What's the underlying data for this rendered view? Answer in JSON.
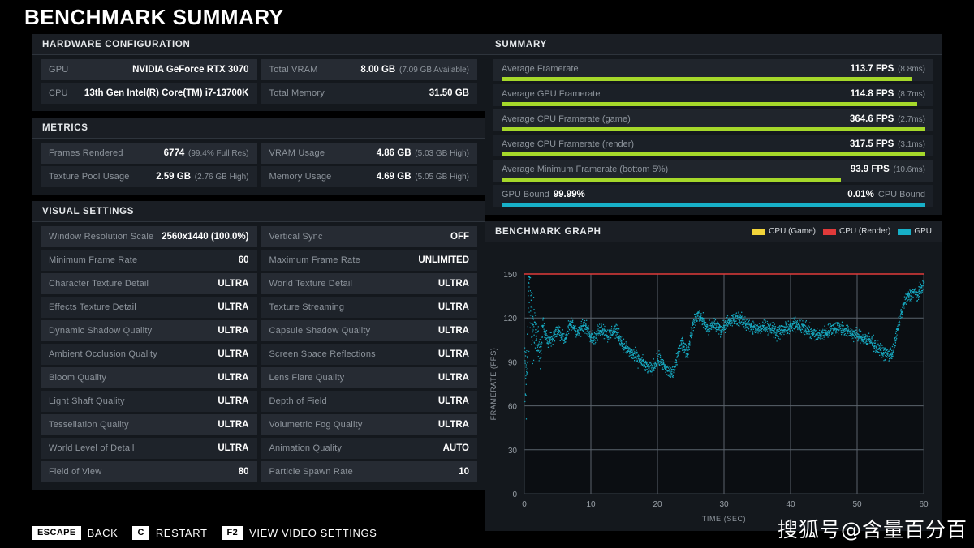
{
  "page_title": "BENCHMARK SUMMARY",
  "hardware": {
    "title": "HARDWARE CONFIGURATION",
    "rows": [
      [
        {
          "label": "GPU",
          "value": "NVIDIA GeForce RTX 3070",
          "sub": ""
        },
        {
          "label": "Total VRAM",
          "value": "8.00 GB",
          "sub": "(7.09 GB Available)"
        }
      ],
      [
        {
          "label": "CPU",
          "value": "13th Gen Intel(R) Core(TM) i7-13700K",
          "sub": ""
        },
        {
          "label": "Total Memory",
          "value": "31.50 GB",
          "sub": ""
        }
      ]
    ]
  },
  "metrics": {
    "title": "METRICS",
    "rows": [
      [
        {
          "label": "Frames Rendered",
          "value": "6774",
          "sub": "(99.4% Full Res)"
        },
        {
          "label": "VRAM Usage",
          "value": "4.86 GB",
          "sub": "(5.03 GB High)"
        }
      ],
      [
        {
          "label": "Texture Pool Usage",
          "value": "2.59 GB",
          "sub": "(2.76 GB High)"
        },
        {
          "label": "Memory Usage",
          "value": "4.69 GB",
          "sub": "(5.05 GB High)"
        }
      ]
    ]
  },
  "visual_settings": {
    "title": "VISUAL SETTINGS",
    "rows": [
      [
        {
          "label": "Window Resolution Scale",
          "value": "2560x1440 (100.0%)",
          "sub": ""
        },
        {
          "label": "Vertical Sync",
          "value": "OFF",
          "sub": ""
        }
      ],
      [
        {
          "label": "Minimum Frame Rate",
          "value": "60",
          "sub": ""
        },
        {
          "label": "Maximum Frame Rate",
          "value": "UNLIMITED",
          "sub": ""
        }
      ],
      [
        {
          "label": "Character Texture Detail",
          "value": "ULTRA",
          "sub": ""
        },
        {
          "label": "World Texture Detail",
          "value": "ULTRA",
          "sub": ""
        }
      ],
      [
        {
          "label": "Effects Texture Detail",
          "value": "ULTRA",
          "sub": ""
        },
        {
          "label": "Texture Streaming",
          "value": "ULTRA",
          "sub": ""
        }
      ],
      [
        {
          "label": "Dynamic Shadow Quality",
          "value": "ULTRA",
          "sub": ""
        },
        {
          "label": "Capsule Shadow Quality",
          "value": "ULTRA",
          "sub": ""
        }
      ],
      [
        {
          "label": "Ambient Occlusion Quality",
          "value": "ULTRA",
          "sub": ""
        },
        {
          "label": "Screen Space Reflections",
          "value": "ULTRA",
          "sub": ""
        }
      ],
      [
        {
          "label": "Bloom Quality",
          "value": "ULTRA",
          "sub": ""
        },
        {
          "label": "Lens Flare Quality",
          "value": "ULTRA",
          "sub": ""
        }
      ],
      [
        {
          "label": "Light Shaft Quality",
          "value": "ULTRA",
          "sub": ""
        },
        {
          "label": "Depth of Field",
          "value": "ULTRA",
          "sub": ""
        }
      ],
      [
        {
          "label": "Tessellation Quality",
          "value": "ULTRA",
          "sub": ""
        },
        {
          "label": "Volumetric Fog Quality",
          "value": "ULTRA",
          "sub": ""
        }
      ],
      [
        {
          "label": "World Level of Detail",
          "value": "ULTRA",
          "sub": ""
        },
        {
          "label": "Animation Quality",
          "value": "AUTO",
          "sub": ""
        }
      ],
      [
        {
          "label": "Field of View",
          "value": "80",
          "sub": ""
        },
        {
          "label": "Particle Spawn Rate",
          "value": "10",
          "sub": ""
        }
      ]
    ]
  },
  "summary": {
    "title": "SUMMARY",
    "bars": [
      {
        "label": "Average Framerate",
        "value": "113.7 FPS",
        "sub": "(8.8ms)",
        "pct": 97,
        "color": "#a5d82a"
      },
      {
        "label": "Average GPU Framerate",
        "value": "114.8 FPS",
        "sub": "(8.7ms)",
        "pct": 98,
        "color": "#a5d82a"
      },
      {
        "label": "Average CPU Framerate (game)",
        "value": "364.6 FPS",
        "sub": "(2.7ms)",
        "pct": 100,
        "color": "#a5d82a"
      },
      {
        "label": "Average CPU Framerate (render)",
        "value": "317.5 FPS",
        "sub": "(3.1ms)",
        "pct": 100,
        "color": "#a5d82a"
      },
      {
        "label": "Average Minimum Framerate (bottom 5%)",
        "value": "93.9 FPS",
        "sub": "(10.6ms)",
        "pct": 80,
        "color": "#a5d82a"
      }
    ],
    "bound": {
      "left_label": "GPU Bound",
      "left_value": "99.99%",
      "right_value": "0.01%",
      "right_label": "CPU Bound",
      "pct": 100,
      "color": "#17b0c8"
    }
  },
  "graph": {
    "title": "BENCHMARK GRAPH",
    "legend": [
      {
        "name": "CPU (Game)",
        "color": "#f2d43a"
      },
      {
        "name": "CPU (Render)",
        "color": "#e03a3a"
      },
      {
        "name": "GPU",
        "color": "#17b0c8"
      }
    ]
  },
  "chart_data": {
    "type": "scatter",
    "title": "BENCHMARK GRAPH",
    "xlabel": "TIME (SEC)",
    "ylabel": "FRAMERATE (FPS)",
    "xlim": [
      0,
      60
    ],
    "ylim": [
      0,
      150
    ],
    "xticks": [
      0,
      10,
      20,
      30,
      40,
      50,
      60
    ],
    "yticks": [
      0,
      30,
      60,
      90,
      120,
      150
    ],
    "grid": true,
    "legend_position": "top-right",
    "series": [
      {
        "name": "GPU",
        "color": "#17b0c8",
        "x": [
          0.3,
          0.6,
          0.9,
          1.2,
          1.5,
          1.8,
          2.1,
          2.4,
          2.7,
          3.0,
          3.5,
          4.0,
          4.5,
          5.0,
          5.5,
          6.0,
          6.5,
          7.0,
          7.5,
          8.0,
          8.5,
          9.0,
          9.5,
          10.0,
          10.5,
          11.0,
          11.5,
          12.0,
          12.5,
          13.0,
          13.5,
          14.0,
          14.5,
          15.0,
          15.5,
          16.0,
          16.5,
          17.0,
          17.5,
          18.0,
          18.5,
          19.0,
          19.5,
          20.0,
          20.5,
          21.0,
          21.5,
          22.0,
          22.5,
          23.0,
          23.5,
          24.0,
          24.5,
          25.0,
          25.5,
          26.0,
          26.5,
          27.0,
          27.5,
          28.0,
          28.5,
          29.0,
          29.5,
          30.0,
          31.0,
          32.0,
          33.0,
          34.0,
          35.0,
          36.0,
          37.0,
          38.0,
          39.0,
          40.0,
          41.0,
          42.0,
          43.0,
          44.0,
          45.0,
          46.0,
          47.0,
          48.0,
          49.0,
          50.0,
          51.0,
          52.0,
          53.0,
          54.0,
          55.0,
          55.5,
          56.0,
          56.5,
          57.0,
          57.5,
          58.0,
          58.5,
          59.0,
          59.5,
          60.0
        ],
        "y": [
          92,
          140,
          133,
          120,
          112,
          105,
          100,
          96,
          118,
          110,
          104,
          106,
          109,
          112,
          108,
          105,
          112,
          116,
          113,
          110,
          113,
          115,
          112,
          108,
          106,
          110,
          113,
          111,
          108,
          110,
          112,
          109,
          104,
          100,
          98,
          96,
          94,
          92,
          90,
          88,
          86,
          85,
          88,
          92,
          90,
          86,
          84,
          82,
          85,
          95,
          104,
          100,
          96,
          110,
          118,
          122,
          120,
          116,
          112,
          114,
          116,
          114,
          112,
          115,
          118,
          120,
          117,
          114,
          112,
          115,
          113,
          110,
          112,
          114,
          116,
          113,
          110,
          108,
          110,
          112,
          114,
          112,
          110,
          108,
          106,
          104,
          100,
          96,
          95,
          100,
          112,
          122,
          130,
          134,
          136,
          138,
          135,
          140,
          142
        ],
        "note": "dense scatter band, each time sample has spread of roughly +/- 6 FPS"
      },
      {
        "name": "CPU (Render)",
        "color": "#e03a3a",
        "x": [
          0,
          60
        ],
        "y": [
          150,
          150
        ],
        "note": "clipped at top of axis (317.5 FPS average, above 150 FPS ylim)"
      },
      {
        "name": "CPU (Game)",
        "color": "#f2d43a",
        "x": [],
        "y": [],
        "note": "only a few stray points visible, otherwise above the 150 FPS ylim"
      }
    ]
  },
  "footer": {
    "keys": [
      {
        "cap": "ESCAPE",
        "action": "BACK"
      },
      {
        "cap": "C",
        "action": "RESTART"
      },
      {
        "cap": "F2",
        "action": "VIEW VIDEO SETTINGS"
      }
    ]
  },
  "watermark": "搜狐号@含量百分百"
}
